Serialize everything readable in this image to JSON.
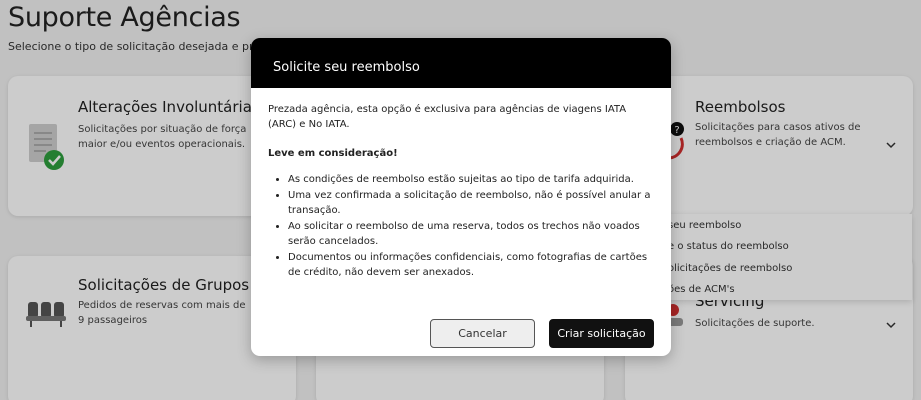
{
  "page": {
    "title": "Suporte Agências",
    "subtitle": "Selecione o tipo de solicitação desejada e preencha"
  },
  "cards": {
    "involuntary": {
      "title": "Alterações Involuntárias",
      "desc": "Solicitações por situação de força maior e/ou eventos operacionais."
    },
    "groups": {
      "title": "Solicitações de Grupos",
      "desc": "Pedidos de reservas com mais de 9 passageiros"
    },
    "refunds": {
      "title": "Reembolsos",
      "desc": "Solicitações para casos ativos de reembolsos e criação de ACM."
    },
    "servicing": {
      "title": "Servicing",
      "desc": "Solicitações de suporte."
    }
  },
  "dropdown": {
    "items": [
      "seu reembolso",
      "e o status do reembolso",
      "olicitações de reembolso",
      "ões de ACM's"
    ]
  },
  "modal": {
    "title": "Solicite seu reembolso",
    "intro": "Prezada agência, esta opção é exclusiva para agências de viagens IATA (ARC) e No IATA.",
    "heading": "Leve em consideração!",
    "bullets": [
      "As condições de reembolso estão sujeitas ao tipo de tarifa adquirida.",
      "Uma vez confirmada a solicitação de reembolso, não é possível anular a transação.",
      "Ao solicitar o reembolso de uma reserva, todos os trechos não voados serão cancelados.",
      "Documentos ou informações confidenciais, como fotografias de cartões de crédito, não devem ser anexados."
    ],
    "cancel_label": "Cancelar",
    "create_label": "Criar solicitação"
  },
  "colors": {
    "accent": "#000000",
    "check": "#2e9e3e",
    "alert": "#d32f2f"
  }
}
